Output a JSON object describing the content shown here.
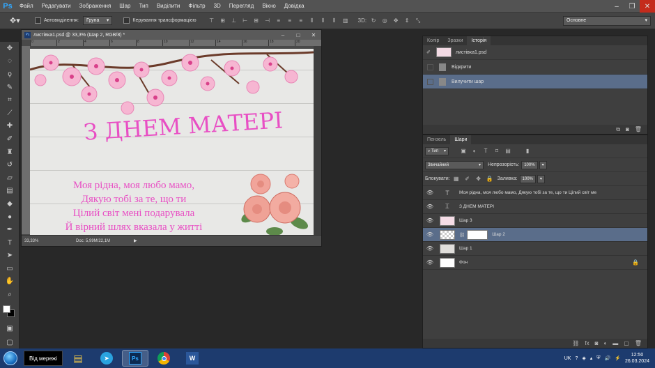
{
  "app": {
    "logo": "Ps"
  },
  "menu": [
    "Файл",
    "Редагувати",
    "Зображення",
    "Шар",
    "Тип",
    "Виділити",
    "Фільтр",
    "3D",
    "Перегляд",
    "Вікно",
    "Довідка"
  ],
  "options": {
    "auto_select_label": "Автовиділення:",
    "auto_select_value": "Група",
    "transform_label": "Керування трансформацією",
    "mode3d": "3D:",
    "workspace": "Основне"
  },
  "document": {
    "tab_title": "листівка1.psd @ 33,3% (Шар 2, RGB/8) *",
    "zoom": "33,33%",
    "doc_size": "Doc: 5,99M/22,1M",
    "ruler_ticks": [
      "0",
      "2",
      "4",
      "6",
      "8",
      "10",
      "12",
      "14",
      "16",
      "18",
      "20"
    ],
    "card_title": "З ДНЕМ МАТЕРІ",
    "poem": [
      "Моя рідна, моя любо мамо,",
      "Дякую тобі за те, що ти",
      "Цілий світ мені подарувала",
      "Й вірний шлях вказала у житті"
    ]
  },
  "history_panel": {
    "tabs": [
      "Колір",
      "Зразки",
      "Історія"
    ],
    "snapshot": "листівка1.psd",
    "items": [
      "Відкрити",
      "Вилучити шар"
    ]
  },
  "layers_panel": {
    "tabs": [
      "Пензель",
      "Шари"
    ],
    "filter": "Тип",
    "blend_mode": "Звичайний",
    "opacity_label": "Непрозорість:",
    "opacity": "100%",
    "lock_label": "Блокувати:",
    "fill_label": "Заливка:",
    "fill": "100%",
    "layers": [
      {
        "name": "Моя рідна, моя любо мамо, Дякую тобі за те, що ти Цілий світ ме",
        "kind": "text"
      },
      {
        "name": "З ДНЕМ МАТЕРІ",
        "kind": "warp-text"
      },
      {
        "name": "Шар 3",
        "kind": "pixel"
      },
      {
        "name": "Шар 2",
        "kind": "pixel-mask"
      },
      {
        "name": "Шар 1",
        "kind": "pixel"
      },
      {
        "name": "Фон",
        "kind": "background"
      }
    ]
  },
  "taskbar": {
    "network_label": "Від мережі",
    "lang": "UK",
    "time": "12:50",
    "date": "26.03.2024"
  },
  "colors": {
    "title_pink": "#e84fc4",
    "selection": "#5a6d8a",
    "taskbar": "#1d3b6e"
  }
}
